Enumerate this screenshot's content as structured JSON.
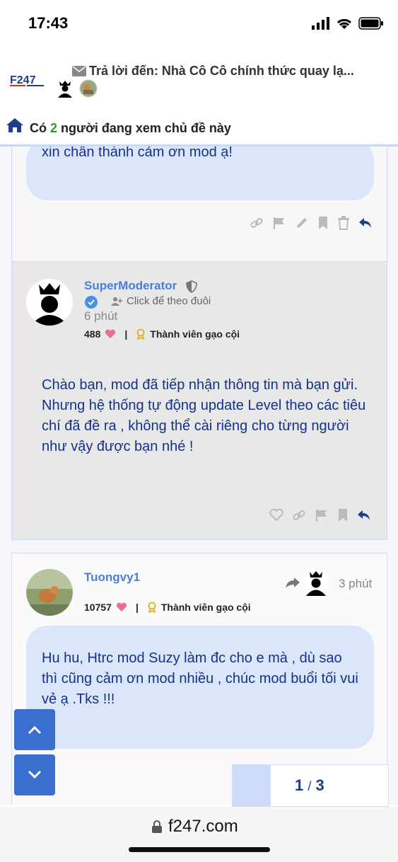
{
  "status_bar": {
    "time": "17:43"
  },
  "header": {
    "logo_text": "F247",
    "thread_title": "Trả lời đến: Nhà Cô Cô chính thức quay lạ...",
    "viewers_prefix": "Có",
    "viewers_count": "2",
    "viewers_suffix": "người đang xem chủ đề này"
  },
  "posts": [
    {
      "message_tail": "xin chân thành cảm ơn mod ạ!"
    },
    {
      "username": "SuperModerator",
      "follow_label": "Click để theo đuôi",
      "time": "6 phút",
      "likes": "488",
      "rank": "Thành viên gạo cội",
      "message": "Chào bạn, mod đã tiếp nhận thông tin mà bạn gửi. Nhưng hệ thống tự động update Level theo các tiêu chí đã đề ra , không thể cài riêng cho từng người như vậy được bạn nhé !"
    },
    {
      "username": "Tuongvy1",
      "time": "3 phút",
      "likes": "10757",
      "rank": "Thành viên gạo cội",
      "message": "Hu hu, Htrc mod Suzy làm đc cho e mà , dù sao thì cũng cảm ơn mod nhiều , chúc mod buổi tối vui vẻ ạ .Tks !!!"
    }
  ],
  "pager": {
    "current": "1",
    "separator": "/",
    "total": "3"
  },
  "browser": {
    "url": "f247.com"
  },
  "colors": {
    "accent": "#3a6fcf",
    "bubble": "#dce6fb",
    "bubble_text": "#13328a",
    "username": "#4a7fd3"
  }
}
